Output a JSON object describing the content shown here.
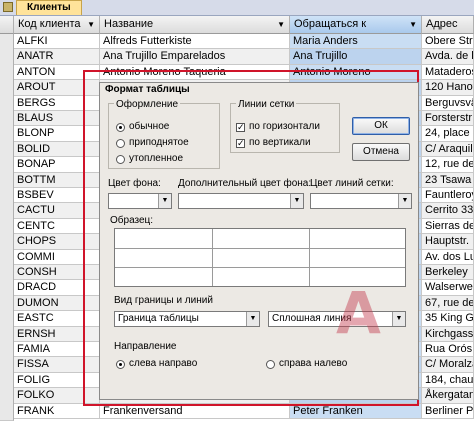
{
  "tab": {
    "label": "Клиенты"
  },
  "grid": {
    "headers": [
      "Код клиента",
      "Название",
      "Обращаться к",
      "Адрес"
    ],
    "rows": [
      [
        "ALFKI",
        "Alfreds Futterkiste",
        "Maria Anders",
        "Obere Str."
      ],
      [
        "ANATR",
        "Ana Trujillo Emparelados",
        "Ana Trujillo",
        "Avda. de l"
      ],
      [
        "ANTON",
        "Antonio Moreno Taqueria",
        "Antonio Moreno",
        "Mataderos"
      ],
      [
        "AROUT",
        "",
        "",
        "120 Hanov"
      ],
      [
        "BERGS",
        "",
        "",
        "Berguvsvä"
      ],
      [
        "BLAUS",
        "",
        "",
        "Forsterstr"
      ],
      [
        "BLONP",
        "",
        "",
        "24, place"
      ],
      [
        "BOLID",
        "",
        "",
        "C/ Araquil"
      ],
      [
        "BONAP",
        "",
        "",
        "12, rue de"
      ],
      [
        "BOTTM",
        "",
        "",
        "23 Tsawa"
      ],
      [
        "BSBEV",
        "",
        "",
        "Fauntleroy"
      ],
      [
        "CACTU",
        "",
        "",
        "Cerrito 33"
      ],
      [
        "CENTC",
        "",
        "",
        "Sierras de"
      ],
      [
        "CHOPS",
        "",
        "",
        "Hauptstr."
      ],
      [
        "COMMI",
        "",
        "",
        "Av. dos Lu"
      ],
      [
        "CONSH",
        "",
        "",
        "Berkeley"
      ],
      [
        "DRACD",
        "",
        "",
        "Walserwe"
      ],
      [
        "DUMON",
        "",
        "",
        "67, rue de"
      ],
      [
        "EASTC",
        "",
        "",
        "35 King G"
      ],
      [
        "ERNSH",
        "",
        "",
        "Kirchgass"
      ],
      [
        "FAMIA",
        "",
        "",
        "Rua Orós"
      ],
      [
        "FISSA",
        "",
        "",
        "C/ Moralza"
      ],
      [
        "FOLIG",
        "Folies gourmandes",
        "Martine Rancé",
        "184, chau"
      ],
      [
        "FOLKO",
        "Folk och fä HB",
        "Maria Larsson",
        "Åkergatan"
      ],
      [
        "FRANK",
        "Frankenversand",
        "Peter Franken",
        "Berliner P"
      ]
    ]
  },
  "dialog": {
    "title": "Формат таблицы",
    "appearance_label": "Оформление",
    "appearance_options": [
      "обычное",
      "приподнятое",
      "утопленное"
    ],
    "gridlines_label": "Линии сетки",
    "gridline_options": [
      "по горизонтали",
      "по вертикали"
    ],
    "ok_label": "ОК",
    "cancel_label": "Отмена",
    "background_color_label": "Цвет фона:",
    "alt_background_color_label": "Дополнительный цвет фона:",
    "gridline_color_label": "Цвет линий сетки:",
    "sample_label": "Образец:",
    "border_style_label": "Вид границы и линий",
    "border_combo_value": "Граница таблицы",
    "line_combo_value": "Сплошная линия",
    "direction_label": "Направление",
    "direction_options": [
      "слева направо",
      "справа налево"
    ]
  },
  "colors": {
    "frame": "#d0142a",
    "selected_column": "#c9ddf3"
  }
}
